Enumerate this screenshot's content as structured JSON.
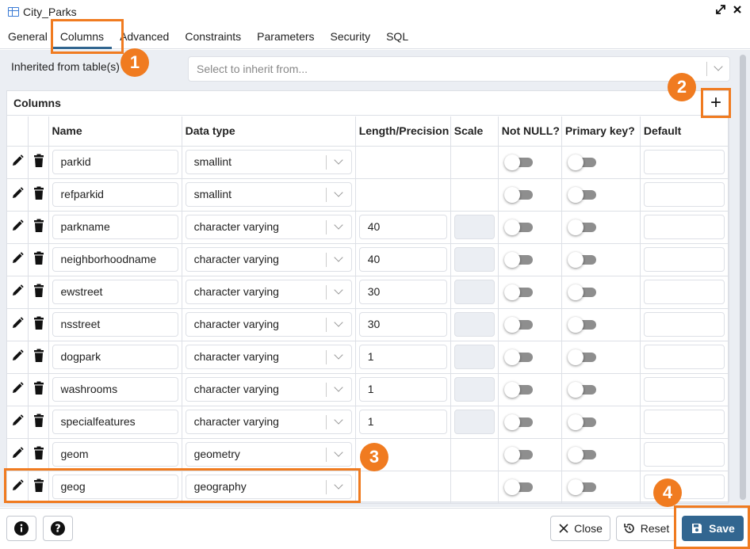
{
  "window": {
    "title": "City_Parks",
    "table_icon": "table-icon",
    "expand_icon": "expand-icon",
    "close_icon": "close-icon"
  },
  "tabs": [
    {
      "label": "General",
      "active": false
    },
    {
      "label": "Columns",
      "active": true
    },
    {
      "label": "Advanced",
      "active": false
    },
    {
      "label": "Constraints",
      "active": false
    },
    {
      "label": "Parameters",
      "active": false
    },
    {
      "label": "Security",
      "active": false
    },
    {
      "label": "SQL",
      "active": false
    }
  ],
  "inherit": {
    "label": "Inherited from table(s)",
    "placeholder": "Select to inherit from..."
  },
  "columns_panel": {
    "title": "Columns",
    "add_icon": "plus-icon",
    "headers": {
      "name": "Name",
      "data_type": "Data type",
      "length": "Length/Precision",
      "scale": "Scale",
      "not_null": "Not NULL?",
      "primary_key": "Primary key?",
      "default": "Default"
    },
    "rows": [
      {
        "name": "parkid",
        "data_type": "smallint",
        "length": ""
      },
      {
        "name": "refparkid",
        "data_type": "smallint",
        "length": ""
      },
      {
        "name": "parkname",
        "data_type": "character varying",
        "length": "40"
      },
      {
        "name": "neighborhoodname",
        "data_type": "character varying",
        "length": "40"
      },
      {
        "name": "ewstreet",
        "data_type": "character varying",
        "length": "30"
      },
      {
        "name": "nsstreet",
        "data_type": "character varying",
        "length": "30"
      },
      {
        "name": "dogpark",
        "data_type": "character varying",
        "length": "1"
      },
      {
        "name": "washrooms",
        "data_type": "character varying",
        "length": "1"
      },
      {
        "name": "specialfeatures",
        "data_type": "character varying",
        "length": "1"
      },
      {
        "name": "geom",
        "data_type": "geometry",
        "length": ""
      },
      {
        "name": "geog",
        "data_type": "geography",
        "length": ""
      }
    ]
  },
  "footer": {
    "info_icon": "info-icon",
    "help_icon": "help-icon",
    "close_label": "Close",
    "reset_label": "Reset",
    "save_label": "Save"
  },
  "callouts": [
    "1",
    "2",
    "3",
    "4"
  ],
  "colors": {
    "accent": "#326690",
    "callout": "#f07b20",
    "background": "#ebeef3",
    "border": "#dde0e6"
  }
}
